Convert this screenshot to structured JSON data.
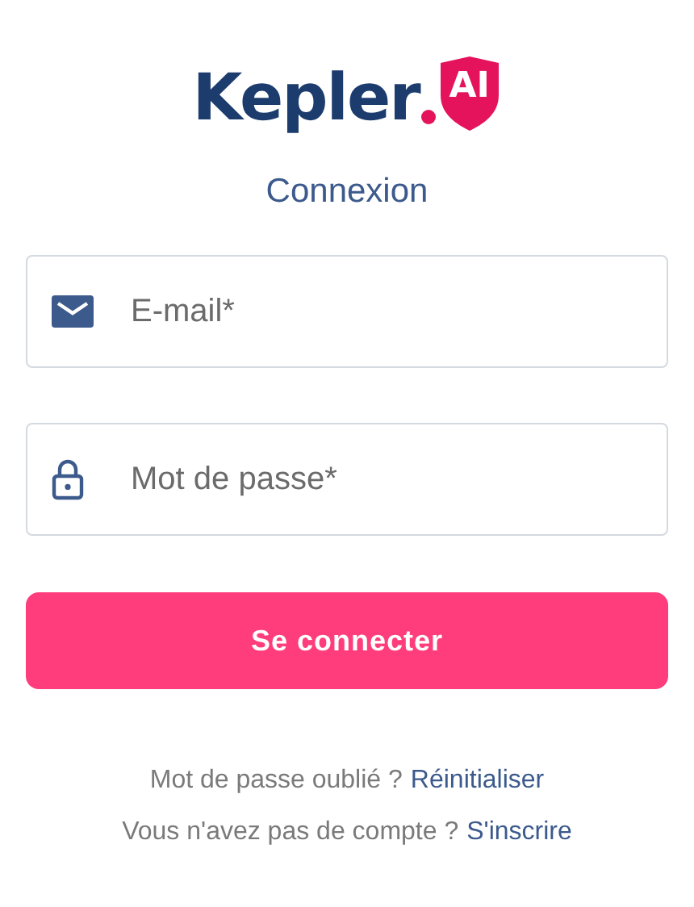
{
  "logo": {
    "name": "Kepler",
    "badge": "AI"
  },
  "title": "Connexion",
  "fields": [
    {
      "kind": "email",
      "placeholder": "E-mail*"
    },
    {
      "kind": "password",
      "placeholder": "Mot de passe*"
    }
  ],
  "submit": "Se connecter",
  "links": [
    {
      "text": "Mot de passe oublié ?",
      "link": "Réinitialiser"
    },
    {
      "text": "Vous n'avez pas de compte ?",
      "link": "S'inscrire"
    }
  ]
}
